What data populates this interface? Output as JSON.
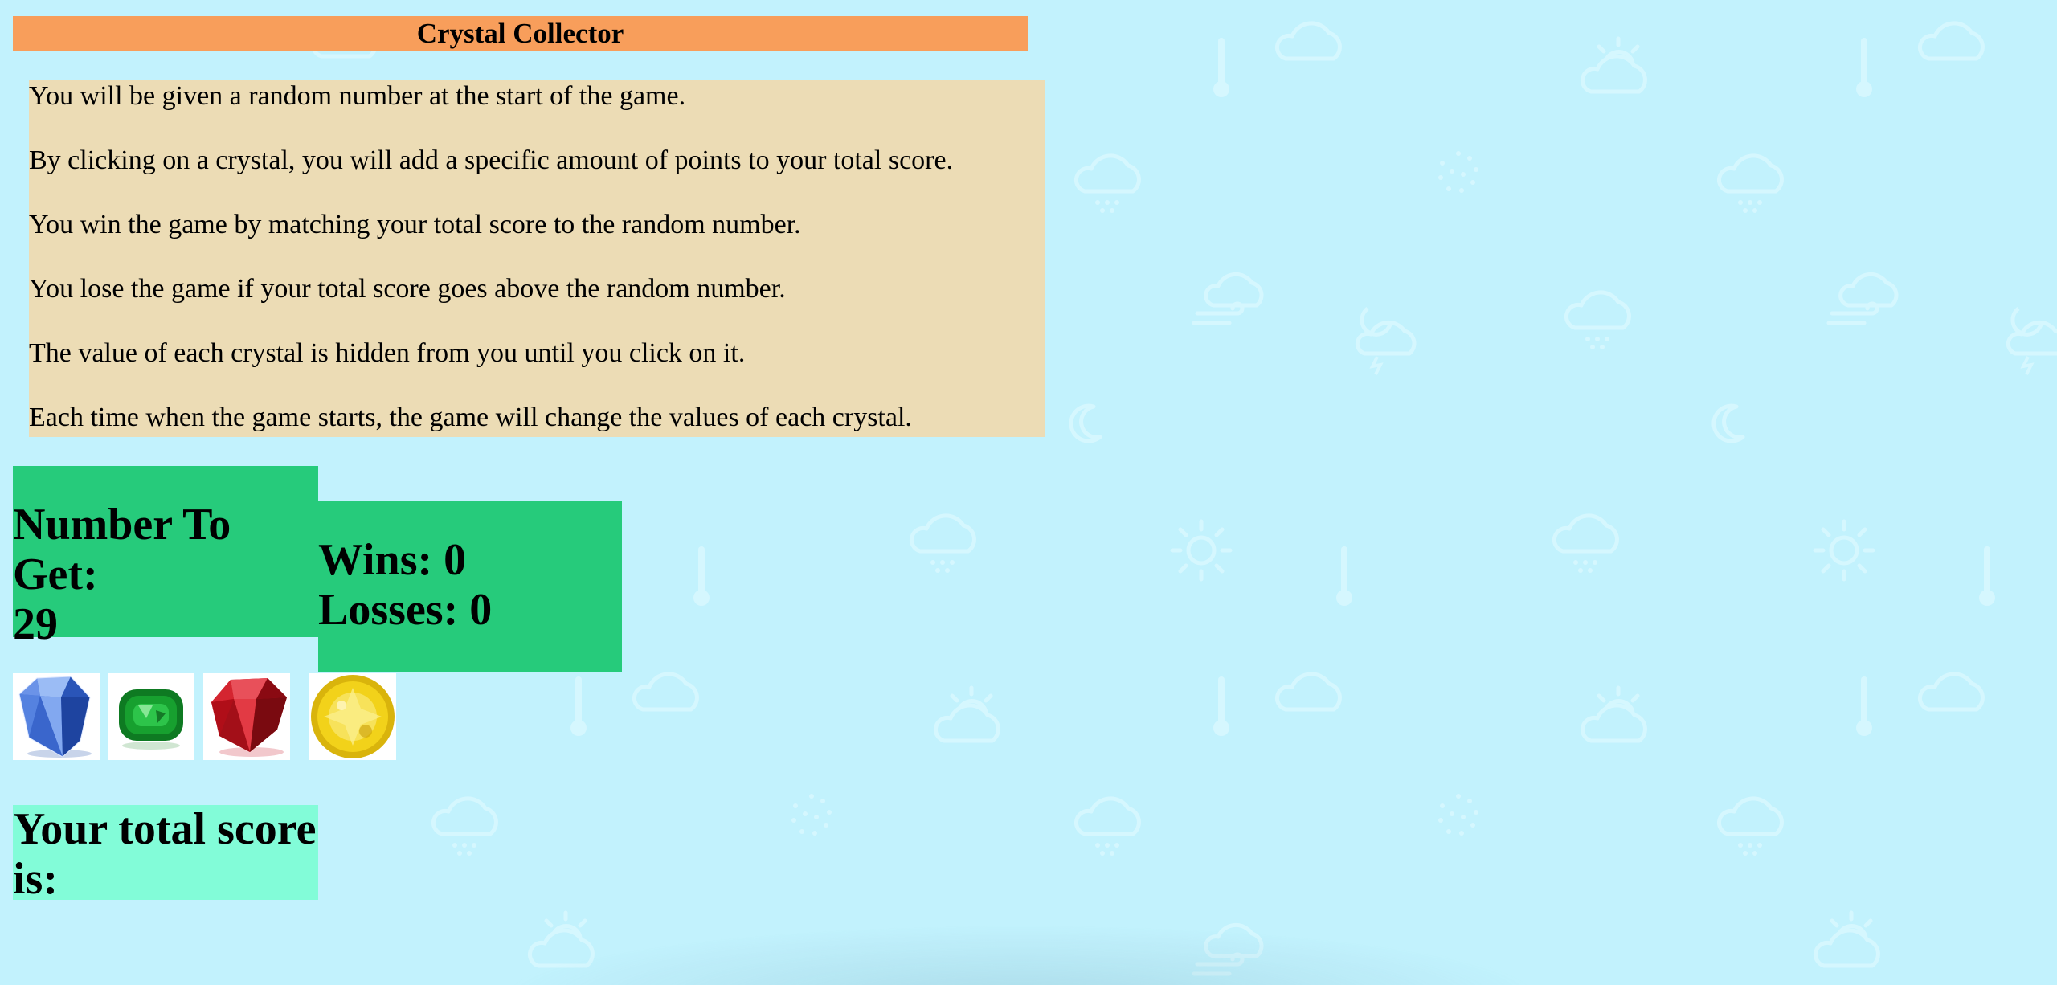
{
  "header": {
    "title": "Crystal Collector"
  },
  "instructions": [
    "You will be given a random number at the start of the game.",
    "By clicking on a crystal, you will add a specific amount of points to your total score.",
    "You win the game by matching your total score to the random number.",
    "You lose the game if your total score goes above the random number.",
    "The value of each crystal is hidden from you until you click on it.",
    "Each time when the game starts, the game will change the values of each crystal."
  ],
  "target": {
    "label": "Number To Get:",
    "value": "29"
  },
  "record": {
    "wins_label": "Wins:",
    "wins": "0",
    "losses_label": "Losses:",
    "losses": "0"
  },
  "crystals": [
    {
      "icon": "blue-diamond-icon",
      "color": "#3f6fd8"
    },
    {
      "icon": "green-emerald-icon",
      "color": "#17a02f"
    },
    {
      "icon": "red-ruby-icon",
      "color": "#c0121b"
    },
    {
      "icon": "yellow-gem-icon",
      "color": "#f2d21a"
    }
  ],
  "score": {
    "label": "Your total score is:",
    "value": ""
  },
  "colors": {
    "background": "#c2f2fd",
    "title_bar": "#f89e5b",
    "instructions_bg": "#ecdcb5",
    "stat_boxes": "#26cb7b",
    "score_box": "#82fcd8"
  }
}
